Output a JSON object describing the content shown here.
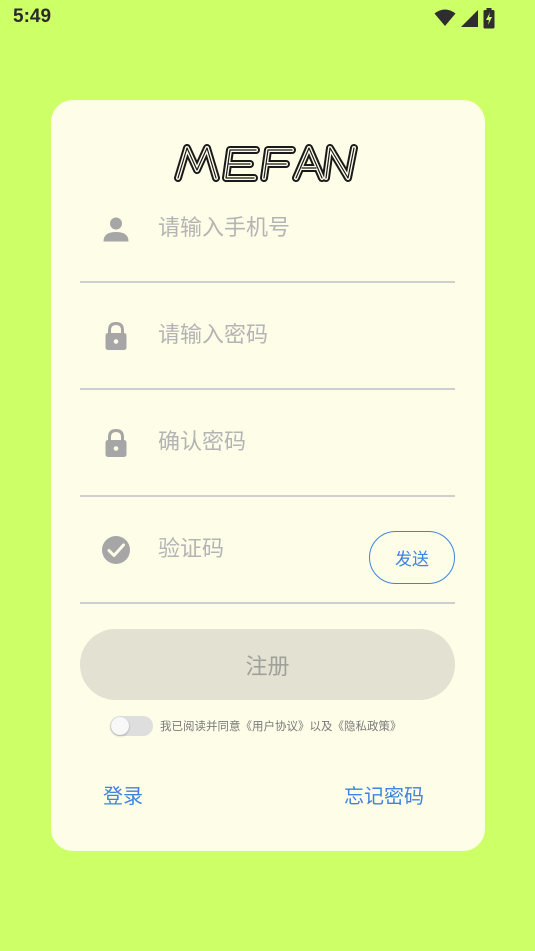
{
  "status_bar": {
    "time": "5:49",
    "icons": [
      "wifi-icon",
      "signal-icon",
      "battery-charging-icon"
    ]
  },
  "logo": {
    "text": "MEFAN"
  },
  "form": {
    "phone": {
      "placeholder": "请输入手机号",
      "icon": "person-icon"
    },
    "password": {
      "placeholder": "请输入密码",
      "icon": "lock-icon"
    },
    "confirm_password": {
      "placeholder": "确认密码",
      "icon": "lock-icon"
    },
    "code": {
      "placeholder": "验证码",
      "icon": "check-circle-icon",
      "send_label": "发送"
    }
  },
  "register_label": "注册",
  "agreement": {
    "text": "我已阅读并同意《用户协议》以及《隐私政策》",
    "toggle_on": false
  },
  "links": {
    "login": "登录",
    "forgot_password": "忘记密码"
  },
  "colors": {
    "background": "#cdff66",
    "card": "#fdfde8",
    "accent": "#3d84e0",
    "icon": "#a6a6a6",
    "register_button": "#e2e1d2"
  }
}
